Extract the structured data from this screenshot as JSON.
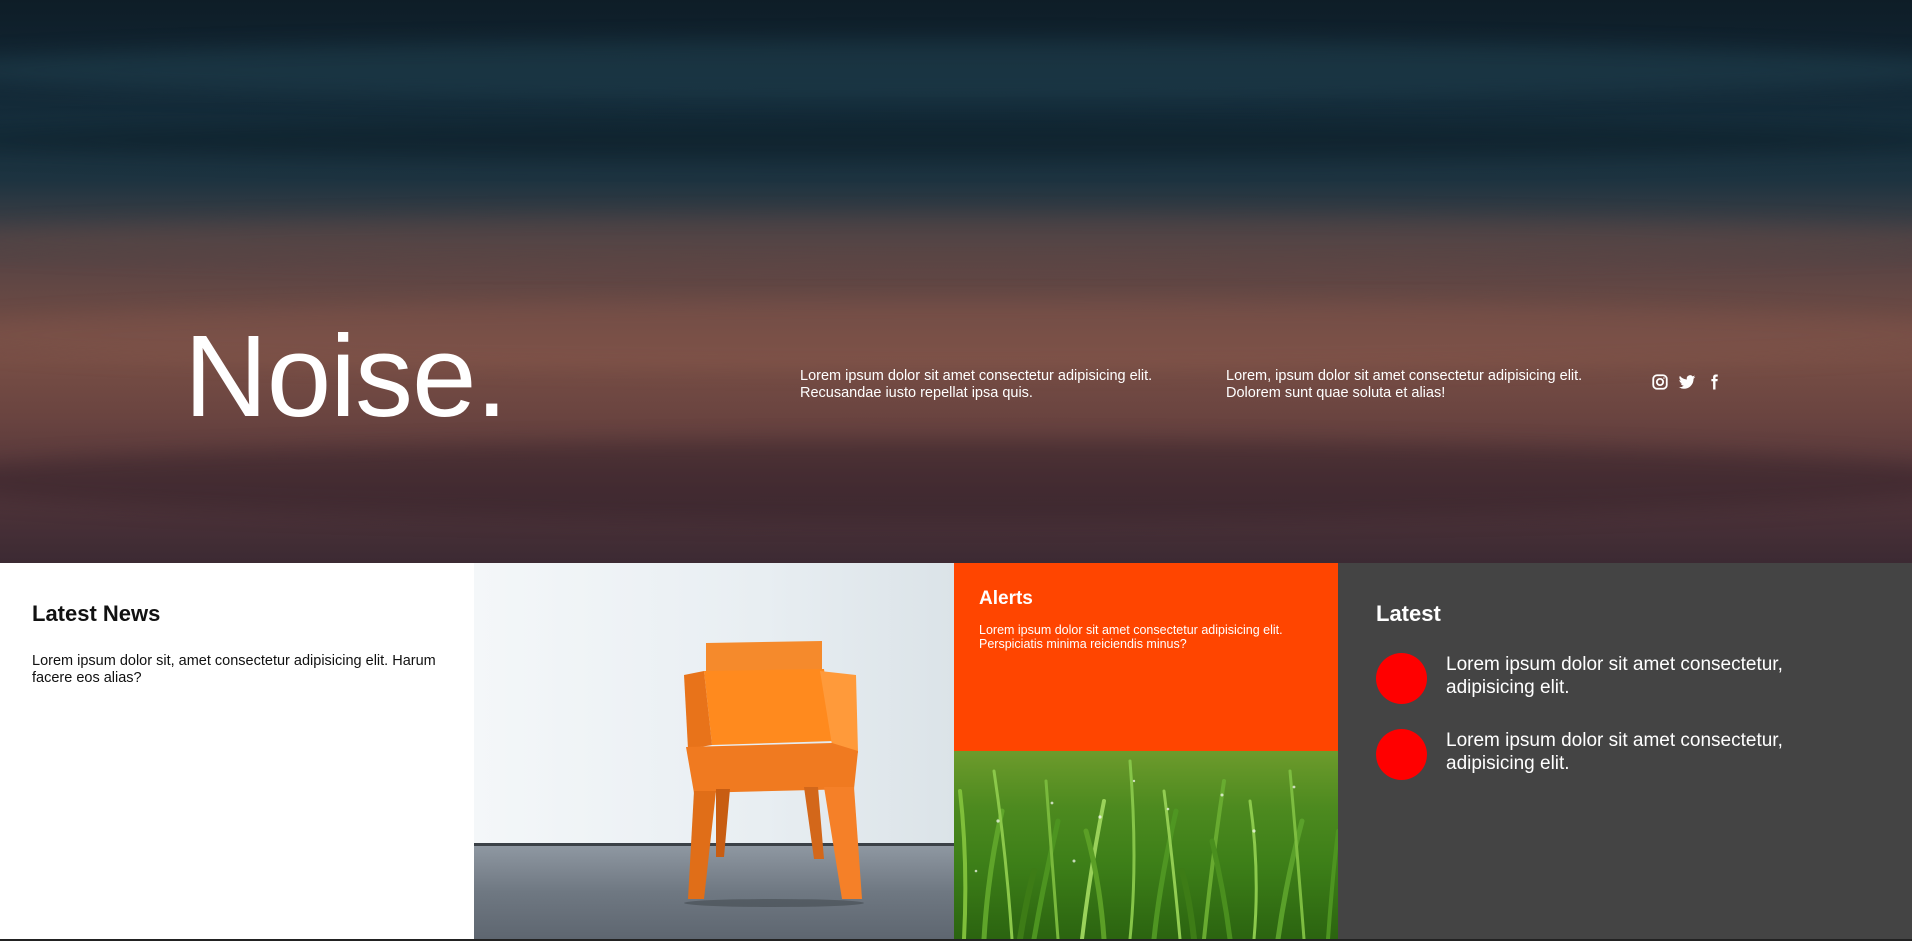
{
  "hero": {
    "title": "Noise.",
    "text_1": "Lorem ipsum dolor sit amet consectetur adipisicing elit. Recusandae iusto repellat ipsa quis.",
    "text_2": "Lorem, ipsum dolor sit amet consectetur adipisicing elit. Dolorem sunt quae soluta et alias!",
    "social_icons": [
      "instagram-icon",
      "twitter-icon",
      "facebook-icon"
    ]
  },
  "news": {
    "title": "Latest News",
    "text": "Lorem ipsum dolor sit, amet consectetur adipisicing elit. Harum facere eos alias?"
  },
  "alerts": {
    "title": "Alerts",
    "text": "Lorem ipsum dolor sit amet consectetur adipisicing elit. Perspiciatis minima reiciendis minus?"
  },
  "latest": {
    "title": "Latest",
    "items": [
      "Lorem ipsum dolor sit amet consectetur, adipisicing elit.",
      "Lorem ipsum dolor sit amet consectetur, adipisicing elit."
    ]
  },
  "colors": {
    "accent": "#ff4500",
    "dot": "#ff0000",
    "latest_bg": "#444444",
    "chair": "#ff8c2a"
  }
}
